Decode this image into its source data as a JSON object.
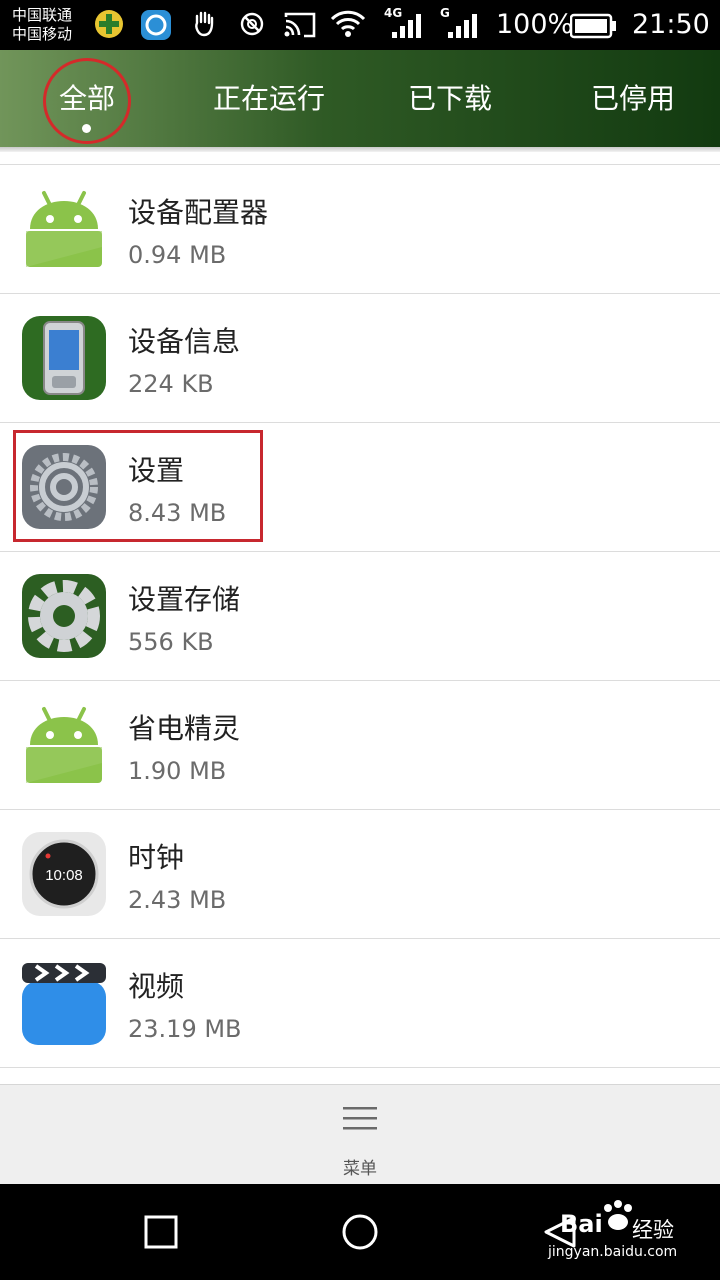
{
  "status_bar": {
    "carrier_1": "中国联通",
    "carrier_2": "中国移动",
    "network_1": "4G",
    "network_2": "G",
    "battery": "100%",
    "time": "21:50"
  },
  "tabs": [
    {
      "label": "全部",
      "selected": true
    },
    {
      "label": "正在运行",
      "selected": false
    },
    {
      "label": "已下载",
      "selected": false
    },
    {
      "label": "已停用",
      "selected": false
    }
  ],
  "apps": [
    {
      "name": "设备配置器",
      "size": "0.94 MB",
      "icon": "android-robot-icon"
    },
    {
      "name": "设备信息",
      "size": "224 KB",
      "icon": "phone-device-icon"
    },
    {
      "name": "设置",
      "size": "8.43 MB",
      "icon": "settings-gear-icon"
    },
    {
      "name": "设置存储",
      "size": "556 KB",
      "icon": "storage-gear-icon"
    },
    {
      "name": "省电精灵",
      "size": "1.90 MB",
      "icon": "android-robot-icon"
    },
    {
      "name": "时钟",
      "size": "2.43 MB",
      "icon": "clock-icon",
      "clock_text": "10:08"
    },
    {
      "name": "视频",
      "size": "23.19 MB",
      "icon": "video-clapper-icon"
    }
  ],
  "menu": {
    "label": "菜单",
    "icon": "hamburger-menu-icon"
  },
  "nav": {
    "recent": "recent-apps-icon",
    "home": "home-icon",
    "back": "back-icon"
  },
  "watermark": {
    "brand_1": "Bai",
    "brand_2": "经验",
    "url": "jingyan.baidu.com"
  },
  "colors": {
    "accent_green": "#2f5a25",
    "annotation_red": "#c7282f"
  }
}
